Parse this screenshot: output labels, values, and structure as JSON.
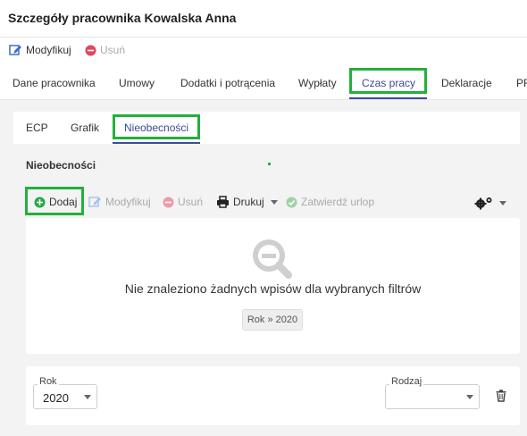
{
  "title": "Szczegóły pracownika Kowalska Anna",
  "toolbar": {
    "modify": "Modyfikuj",
    "delete": "Usuń"
  },
  "tabs": [
    "Dane pracownika",
    "Umowy",
    "Dodatki i potrącenia",
    "Wypłaty",
    "Czas pracy",
    "Deklaracje",
    "PF"
  ],
  "subtabs": [
    "ECP",
    "Grafik",
    "Nieobecności"
  ],
  "section": {
    "title": "Nieobecności",
    "actions": {
      "add": "Dodaj",
      "modify": "Modyfikuj",
      "delete": "Usuń",
      "print": "Drukuj",
      "approve": "Zatwierdź urlop"
    }
  },
  "empty": {
    "message": "Nie znaleziono żadnych wpisów dla wybranych filtrów",
    "chip": "Rok » 2020"
  },
  "filters": {
    "year_label": "Rok",
    "year_value": "2020",
    "kind_label": "Rodzaj",
    "kind_value": ""
  },
  "colors": {
    "accent": "#3a4a9a",
    "highlight": "#22b03a",
    "danger": "#e2475b",
    "success": "#5cb85c",
    "link": "#3c6fc7"
  }
}
